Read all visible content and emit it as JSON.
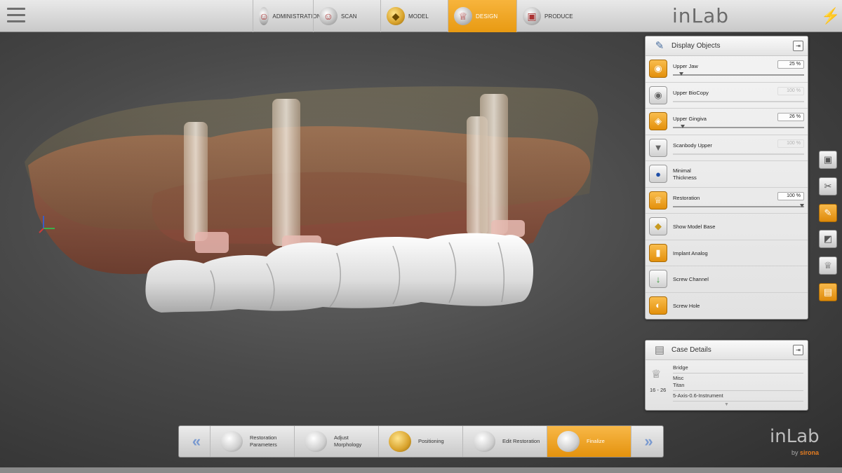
{
  "topbar": {
    "steps": [
      {
        "label": "ADMINISTRATION",
        "icon": "jaw-icon"
      },
      {
        "label": "SCAN",
        "icon": "scan-jaw-icon"
      },
      {
        "label": "MODEL",
        "icon": "model-icon"
      },
      {
        "label": "DESIGN",
        "icon": "crown-design-icon"
      },
      {
        "label": "PRODUCE",
        "icon": "mill-block-icon"
      }
    ],
    "brand": "inLab"
  },
  "display_objects": {
    "title": "Display Objects",
    "items": [
      {
        "label": "Upper Jaw",
        "value": "25 %",
        "slider": 0.05
      },
      {
        "label": "Upper BioCopy",
        "value": "100 %",
        "slider": 1.0
      },
      {
        "label": "Upper Gingiva",
        "value": "26 %",
        "slider": 0.06
      },
      {
        "label": "Scanbody Upper",
        "value": "100 %",
        "slider": 1.0
      },
      {
        "label": "Minimal",
        "label2": "Thickness"
      },
      {
        "label": "Restoration",
        "value": "100 %",
        "slider": 1.0
      },
      {
        "label": "Show Model Base"
      },
      {
        "label": "Implant Analog"
      },
      {
        "label": "Screw Channel"
      },
      {
        "label": "Screw Hole"
      }
    ]
  },
  "case_details": {
    "title": "Case Details",
    "type": "Bridge",
    "range": "16 - 26",
    "material1": "Misc",
    "material2": "Titan",
    "instrument": "5-Axis-0.6-Instrument"
  },
  "bottom_steps": [
    {
      "label": "Restoration",
      "label2": "Parameters"
    },
    {
      "label": "Adjust",
      "label2": "Morphology"
    },
    {
      "label": "Positioning",
      "label2": ""
    },
    {
      "label": "Edit Restoration",
      "label2": ""
    },
    {
      "label": "Finalize",
      "label2": ""
    }
  ],
  "brand_bottom": "inLab",
  "brand_by": "by",
  "brand_company": "sirona"
}
